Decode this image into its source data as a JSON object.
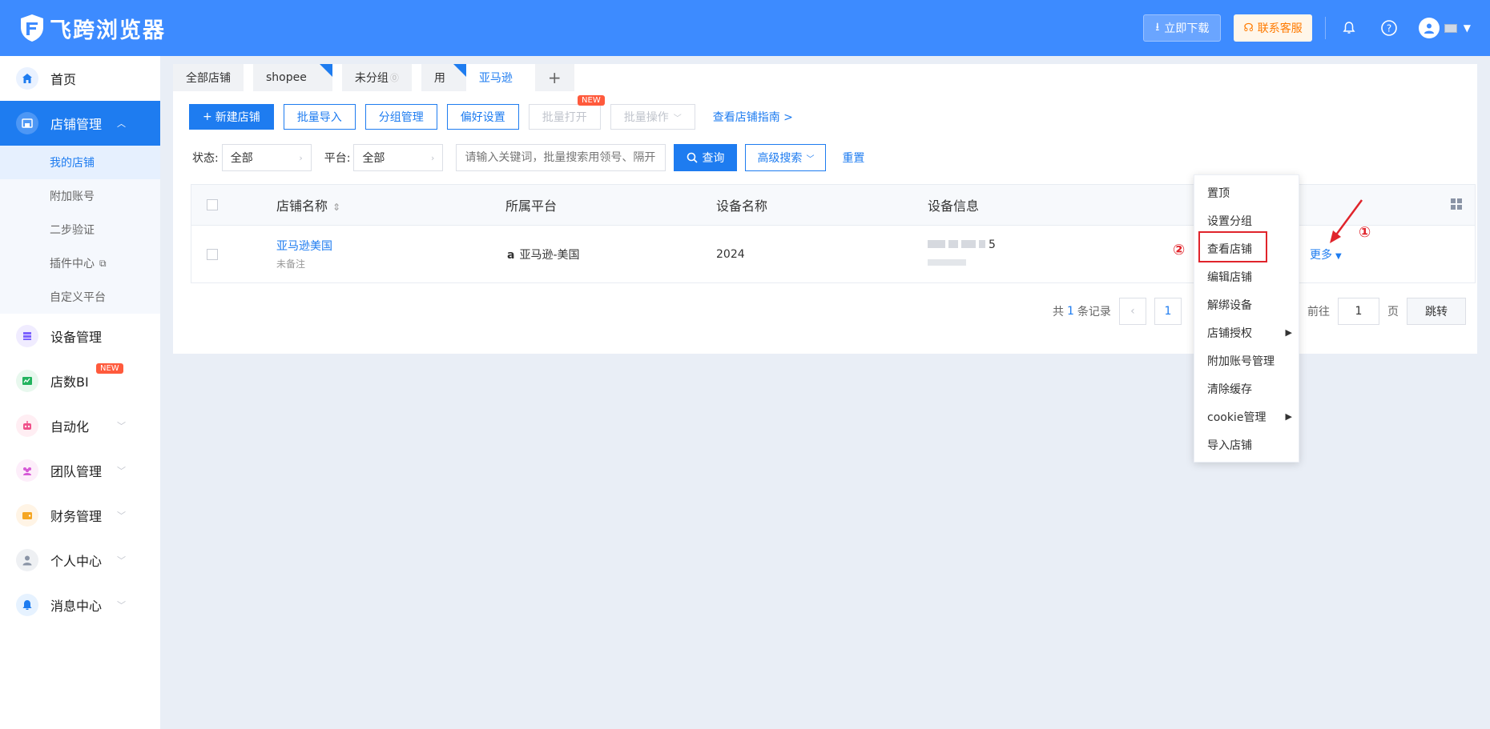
{
  "header": {
    "logo_text": "飞跨浏览器",
    "download_label": "立即下载",
    "service_label": "联系客服"
  },
  "sidebar": {
    "items": [
      {
        "label": "首页"
      },
      {
        "label": "店铺管理"
      },
      {
        "label": "设备管理"
      },
      {
        "label": "店数BI",
        "badge": "NEW"
      },
      {
        "label": "自动化"
      },
      {
        "label": "团队管理"
      },
      {
        "label": "财务管理"
      },
      {
        "label": "个人中心"
      },
      {
        "label": "消息中心"
      }
    ],
    "sub_items": [
      {
        "label": "我的店铺"
      },
      {
        "label": "附加账号"
      },
      {
        "label": "二步验证"
      },
      {
        "label": "插件中心"
      },
      {
        "label": "自定义平台"
      }
    ]
  },
  "tabs": [
    {
      "label": "全部店铺"
    },
    {
      "label": "shopee"
    },
    {
      "label": "未分组"
    },
    {
      "label": "用"
    },
    {
      "label": "亚马逊"
    }
  ],
  "toolbar": {
    "new_store": "新建店铺",
    "batch_import": "批量导入",
    "group_manage": "分组管理",
    "preferences": "偏好设置",
    "batch_open": "批量打开",
    "batch_open_badge": "NEW",
    "batch_ops": "批量操作",
    "guide_link": "查看店铺指南 >"
  },
  "filters": {
    "status_label": "状态:",
    "status_value": "全部",
    "platform_label": "平台:",
    "platform_value": "全部",
    "search_placeholder": "请输入关键词，批量搜索用领号、隔开",
    "query_label": "查询",
    "advanced_label": "高级搜索",
    "reset_label": "重置"
  },
  "table": {
    "headers": [
      "店铺名称",
      "所属平台",
      "设备名称",
      "设备信息"
    ],
    "rows": [
      {
        "store_name": "亚马逊美国",
        "note": "未备注",
        "platform": "亚马逊-美国",
        "device_name": "2024",
        "device_info_suffix": "5",
        "more_label": "更多"
      }
    ]
  },
  "pagination": {
    "total_prefix": "共",
    "total_count": "1",
    "total_suffix": "条记录",
    "current_page": "1",
    "goto_label": "前往",
    "goto_value": "1",
    "page_unit": "页",
    "jump_label": "跳转"
  },
  "dropdown": {
    "items": [
      {
        "label": "置顶"
      },
      {
        "label": "设置分组"
      },
      {
        "label": "查看店铺"
      },
      {
        "label": "编辑店铺"
      },
      {
        "label": "解绑设备"
      },
      {
        "label": "店铺授权",
        "submenu": true
      },
      {
        "label": "附加账号管理"
      },
      {
        "label": "清除缓存"
      },
      {
        "label": "cookie管理",
        "submenu": true
      },
      {
        "label": "导入店铺"
      }
    ]
  },
  "annotations": {
    "step1": "①",
    "step2": "②"
  },
  "colors": {
    "header_bg": "#3d8bff",
    "primary": "#1e7cf0",
    "annotation_red": "#e0242b",
    "new_badge": "#ff5a3c"
  }
}
